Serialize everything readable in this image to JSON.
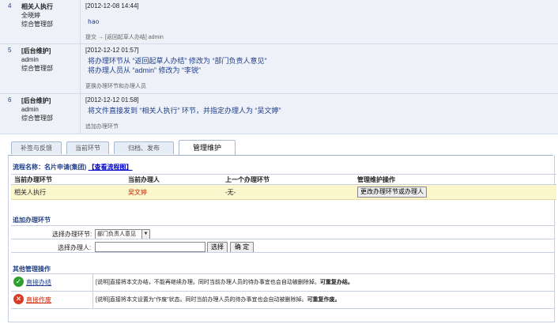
{
  "logs": [
    {
      "num": "4",
      "name": "相关人执行",
      "user": "全晓婷",
      "dept": "综合管理部",
      "time": "[2012-12-08 14:44]",
      "lines": [
        "hao"
      ],
      "note": "提交 → [返回起草人办结] admin"
    },
    {
      "num": "5",
      "name": "[后台维护]",
      "user": "admin",
      "dept": "综合管理部",
      "time": "[2012-12-12 01:57]",
      "lines": [
        "将办理环节从 “返回起草人办结” 修改为 “部门负责人意见”",
        "将办理人员从 “admin” 修改为 “李锐”"
      ],
      "note": "更换办理环节和办理人员"
    },
    {
      "num": "6",
      "name": "[后台维护]",
      "user": "admin",
      "dept": "综合管理部",
      "time": "[2012-12-12 01:58]",
      "lines": [
        "将文件直接发到 “相关人执行” 环节，并指定办理人为 “吴文婷”"
      ],
      "note": "追加办理环节"
    }
  ],
  "tabs": [
    "补签与反馈",
    "当前环节",
    "归档、发布",
    "管理维护"
  ],
  "flow": {
    "title": "流程名称：名片申请(集团)",
    "view_link": "【查看流程图】"
  },
  "table": {
    "headers": [
      "当前办理环节",
      "当前办理人",
      "上一个办理环节",
      "管理维护操作"
    ],
    "row": {
      "step": "相关人执行",
      "handler": "吴文婷",
      "prev": "-无-",
      "button": "更改办理环节或办理人"
    }
  },
  "add_step": {
    "title": "追加办理环节",
    "select_label": "选择办理环节:",
    "select_value": "部门负责人意见",
    "person_label": "选择办理人:",
    "choose_btn": "选择",
    "ok_btn": "确 定"
  },
  "other": {
    "title": "其他管理操作",
    "ops": [
      {
        "link": "直接办结",
        "desc_plain": "[说明]直接将本文办结，不能再继续办理。同时当前办理人员的待办事宜也会自动被删除掉。",
        "desc_bold": "可重复办结。",
        "color": "#2e9e2e",
        "icon": "✓"
      },
      {
        "link": "直接作废",
        "desc_plain": "[说明]直接将本文设置为“作废”状态。同时当前办理人员的待办事宜也会自动被删除掉。",
        "desc_bold": "可重复作废。",
        "color": "#d83a2a",
        "icon": "✕"
      }
    ]
  },
  "colors": {
    "blue": "#1f3f8c",
    "red_text": "#cc2200"
  }
}
